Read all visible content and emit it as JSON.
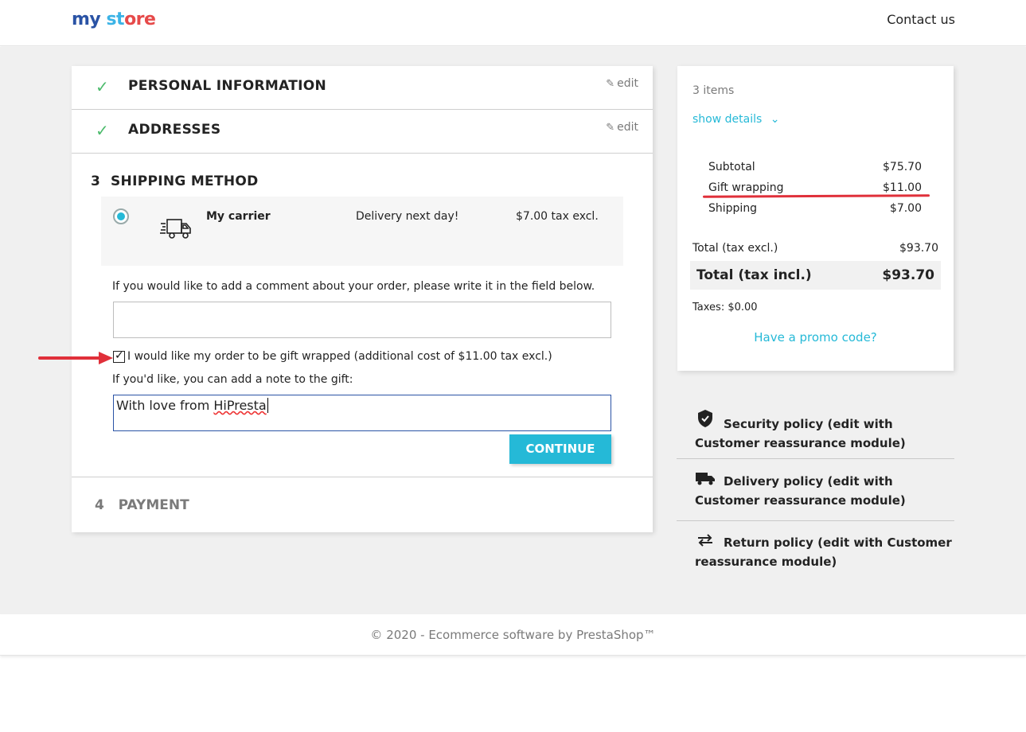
{
  "header": {
    "logo_part1": "my",
    "logo_part2": "st",
    "logo_part3": "ore",
    "contact_label": "Contact us"
  },
  "steps": {
    "personal": {
      "title": "PERSONAL INFORMATION",
      "edit_label": "edit",
      "status_icon": "check-icon"
    },
    "addresses": {
      "title": "ADDRESSES",
      "edit_label": "edit",
      "status_icon": "check-icon"
    },
    "shipping": {
      "number": "3",
      "title": "SHIPPING METHOD"
    },
    "payment": {
      "number": "4",
      "title": "PAYMENT"
    }
  },
  "carrier": {
    "name": "My carrier",
    "delay": "Delivery next day!",
    "price": "$7.00 tax excl.",
    "selected": true
  },
  "comment": {
    "label": "If you would like to add a comment about your order, please write it in the field below.",
    "value": ""
  },
  "gift": {
    "checked": true,
    "label": "I would like my order to be gift wrapped (additional cost of $11.00 tax excl.)",
    "note_label": "If you'd like, you can add a note to the gift:",
    "note_value_prefix": "With love from ",
    "note_value_word": "HiPresta"
  },
  "continue_label": "CONTINUE",
  "summary": {
    "items_count": "3 items",
    "show_details": "show details",
    "lines": [
      {
        "label": "Subtotal",
        "value": "$75.70"
      },
      {
        "label": "Gift wrapping",
        "value": "$11.00"
      },
      {
        "label": "Shipping",
        "value": "$7.00"
      }
    ],
    "total_excl_label": "Total (tax excl.)",
    "total_excl_value": "$93.70",
    "total_incl_label": "Total (tax incl.)",
    "total_incl_value": "$93.70",
    "taxes": "Taxes: $0.00",
    "promo": "Have a promo code?"
  },
  "reassurance": [
    {
      "icon": "shield-icon",
      "line1": "Security policy (edit with",
      "line2": "Customer reassurance module)"
    },
    {
      "icon": "truck-icon",
      "line1": "Delivery policy (edit with",
      "line2": "Customer reassurance module)"
    },
    {
      "icon": "swap-arrows-icon",
      "line1": "Return policy (edit with Customer",
      "line2": "reassurance module)"
    }
  ],
  "footer": "© 2020 - Ecommerce software by PrestaShop™",
  "colors": {
    "accent": "#25b9d7",
    "check": "#4cbb6c",
    "annotation": "#e0303a"
  }
}
